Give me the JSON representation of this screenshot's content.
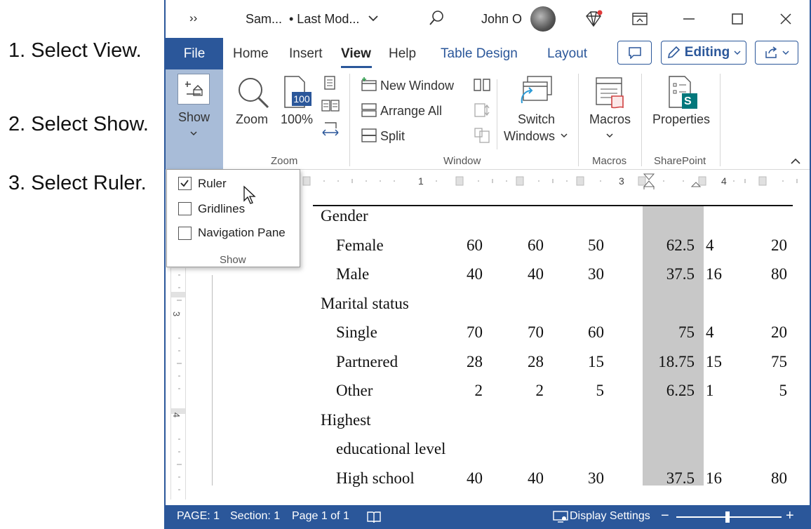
{
  "instructions": [
    "1. Select View.",
    "2. Select Show.",
    "3. Select Ruler."
  ],
  "titlebar": {
    "overflow": "››",
    "doc_name": "Sam...",
    "last_modified": "• Last Mod...",
    "user": "John O"
  },
  "tabs": {
    "file": "File",
    "home": "Home",
    "insert": "Insert",
    "view": "View",
    "help": "Help",
    "table_design": "Table Design",
    "layout": "Layout",
    "editing": "Editing"
  },
  "ribbon": {
    "show": "Show",
    "zoom": "Zoom",
    "zoom100": "100%",
    "zoom_icon_value": "100",
    "group_zoom": "Zoom",
    "new_window": "New Window",
    "arrange_all": "Arrange All",
    "split": "Split",
    "switch": "Switch",
    "windows": "Windows",
    "group_window": "Window",
    "macros": "Macros",
    "group_macros": "Macros",
    "properties": "Properties",
    "group_sharepoint": "SharePoint",
    "sharepoint_letter": "S"
  },
  "show_menu": {
    "items": [
      {
        "label": "Ruler",
        "checked": true
      },
      {
        "label": "Gridlines",
        "checked": false
      },
      {
        "label": "Navigation Pane",
        "checked": false
      }
    ],
    "group_label": "Show"
  },
  "ruler": {
    "h_labels": [
      "1",
      "3",
      "4"
    ],
    "v_labels": [
      "3",
      "4"
    ]
  },
  "table": {
    "rows": [
      {
        "label": "Gender",
        "indent": false,
        "values": [
          "",
          "",
          "",
          "",
          "",
          ""
        ]
      },
      {
        "label": "Female",
        "indent": true,
        "values": [
          "60",
          "60",
          "50",
          "62.5",
          "4",
          "20"
        ]
      },
      {
        "label": "Male",
        "indent": true,
        "values": [
          "40",
          "40",
          "30",
          "37.5",
          "16",
          "80"
        ]
      },
      {
        "label": "Marital status",
        "indent": false,
        "values": [
          "",
          "",
          "",
          "",
          "",
          ""
        ]
      },
      {
        "label": "Single",
        "indent": true,
        "values": [
          "70",
          "70",
          "60",
          "75",
          "4",
          "20"
        ]
      },
      {
        "label": "Partnered",
        "indent": true,
        "values": [
          "28",
          "28",
          "15",
          "18.75",
          "15",
          "75"
        ]
      },
      {
        "label": "Other",
        "indent": true,
        "values": [
          "2",
          "2",
          "5",
          "6.25",
          "1",
          "5"
        ]
      },
      {
        "label": "Highest",
        "indent": false,
        "values": [
          "",
          "",
          "",
          "",
          "",
          ""
        ]
      },
      {
        "label": "educational level",
        "indent": true,
        "values": [
          "",
          "",
          "",
          "",
          "",
          ""
        ]
      },
      {
        "label": "High school",
        "indent": true,
        "values": [
          "40",
          "40",
          "30",
          "37.5",
          "16",
          "80"
        ]
      }
    ]
  },
  "status": {
    "page": "PAGE: 1",
    "section": "Section: 1",
    "page_of": "Page 1 of 1",
    "display_settings": "Display Settings",
    "minus": "−",
    "plus": "+"
  },
  "colors": {
    "accent": "#2b579a",
    "shade": "#c8c8c8",
    "show_active": "#a8bcd8"
  }
}
